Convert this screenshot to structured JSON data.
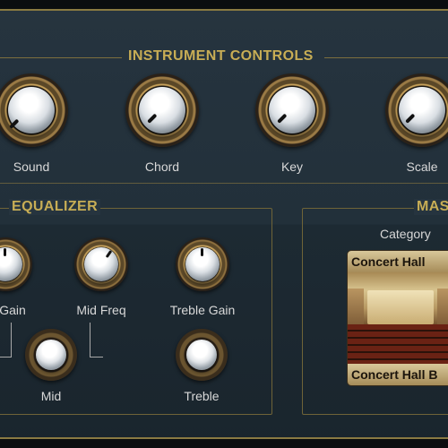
{
  "sections": {
    "instrument_controls": "INSTRUMENT CONTROLS",
    "equalizer": "EQUALIZER",
    "master_partial": "MAS"
  },
  "instrument_knobs": [
    {
      "label": "Sound"
    },
    {
      "label": "Chord"
    },
    {
      "label": "Key"
    },
    {
      "label": "Scale"
    }
  ],
  "eq_knobs": [
    {
      "label": "Gain"
    },
    {
      "label": "Mid Freq"
    },
    {
      "label": "Treble Gain"
    }
  ],
  "eq_buttons": [
    {
      "label": "Mid"
    },
    {
      "label": "Treble"
    }
  ],
  "master": {
    "category_label": "Category",
    "preset_top": "Concert Hall",
    "preset_bottom": "Concert Hall B"
  },
  "colors": {
    "accent_gold": "#c7ad55",
    "line_gold": "#7d6f3e",
    "label_text": "#d8d8d8"
  }
}
